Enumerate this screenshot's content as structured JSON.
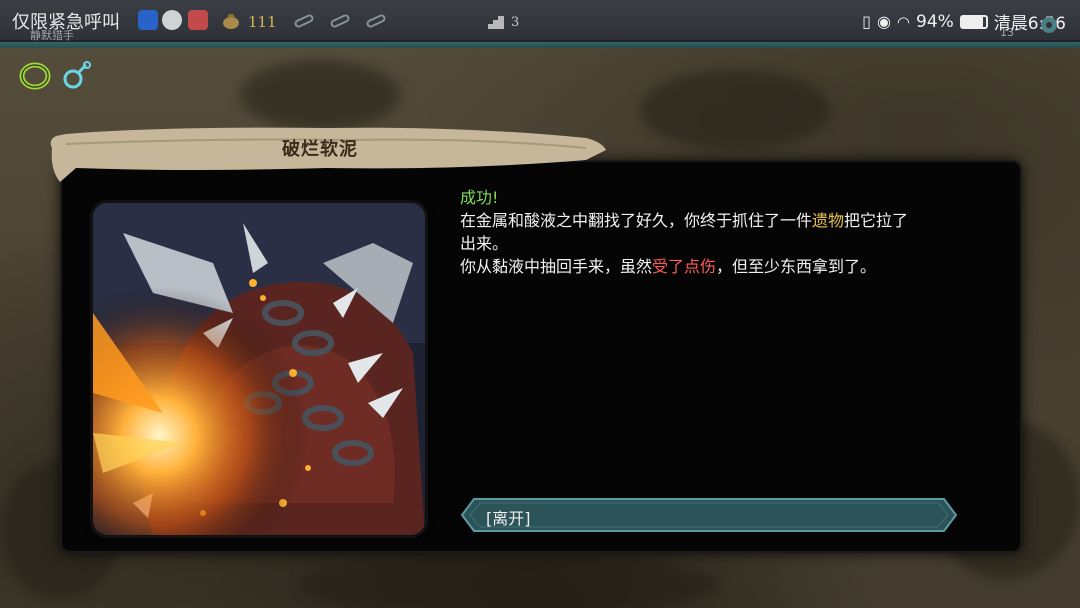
{
  "status_bar": {
    "notification": "仅限紧急呼叫",
    "battery": "94%",
    "time": "清晨6:56"
  },
  "top_bar": {
    "player_name": "静默猎手",
    "gold": "111",
    "floor": "3",
    "deck_count": "13"
  },
  "event": {
    "title": "破烂软泥",
    "success": "成功!",
    "line1_pre": "在金属和酸液之中翻找了好久，你终于抓住了一件",
    "line1_highlight": "遗物",
    "line1_post": "把它拉了",
    "line2": "出来。",
    "line3_pre": "你从黏液中抽回手来，虽然",
    "line3_highlight": "受了点伤",
    "line3_post": "，但至少东西拿到了。",
    "option_label": "[离开]"
  },
  "colors": {
    "success": "#7fdc55",
    "gold_highlight": "#e8c14e",
    "damage_highlight": "#ff5b5b",
    "option_fill": "#2c5358"
  },
  "icons": [
    "blue-avatar-icon",
    "chat-icon",
    "red-app-icon",
    "gold-bag-icon",
    "potion-slot-icon",
    "floor-icon",
    "vibrate-icon",
    "eye-icon",
    "wifi-icon",
    "battery-icon",
    "deck-icon",
    "gear-icon",
    "ring-relic-icon",
    "potion-relic-icon"
  ]
}
